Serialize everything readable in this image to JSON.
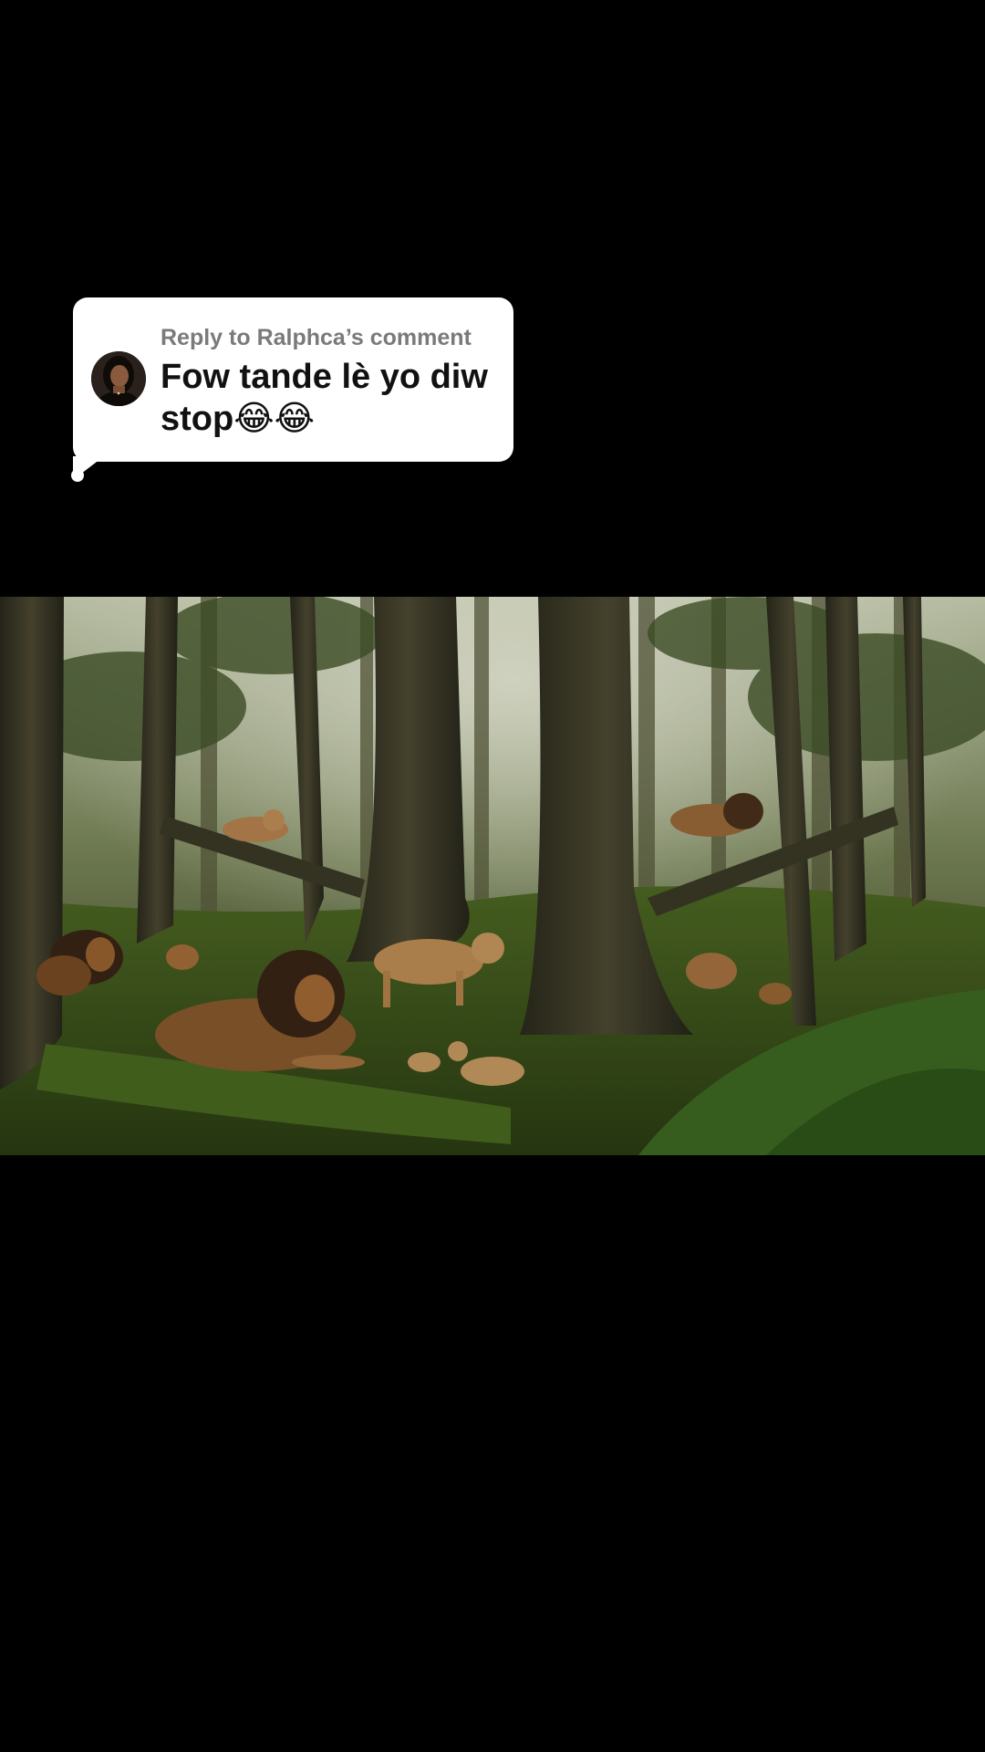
{
  "reply": {
    "label": "Reply to Ralphca’s comment",
    "text": "Fow tande lè yo diw stop😂😂"
  },
  "video": {
    "scene": "forest-lions-frame"
  },
  "colors": {
    "background": "#000000",
    "bubble": "#ffffff",
    "label": "#7a7a7a",
    "text": "#111111"
  }
}
